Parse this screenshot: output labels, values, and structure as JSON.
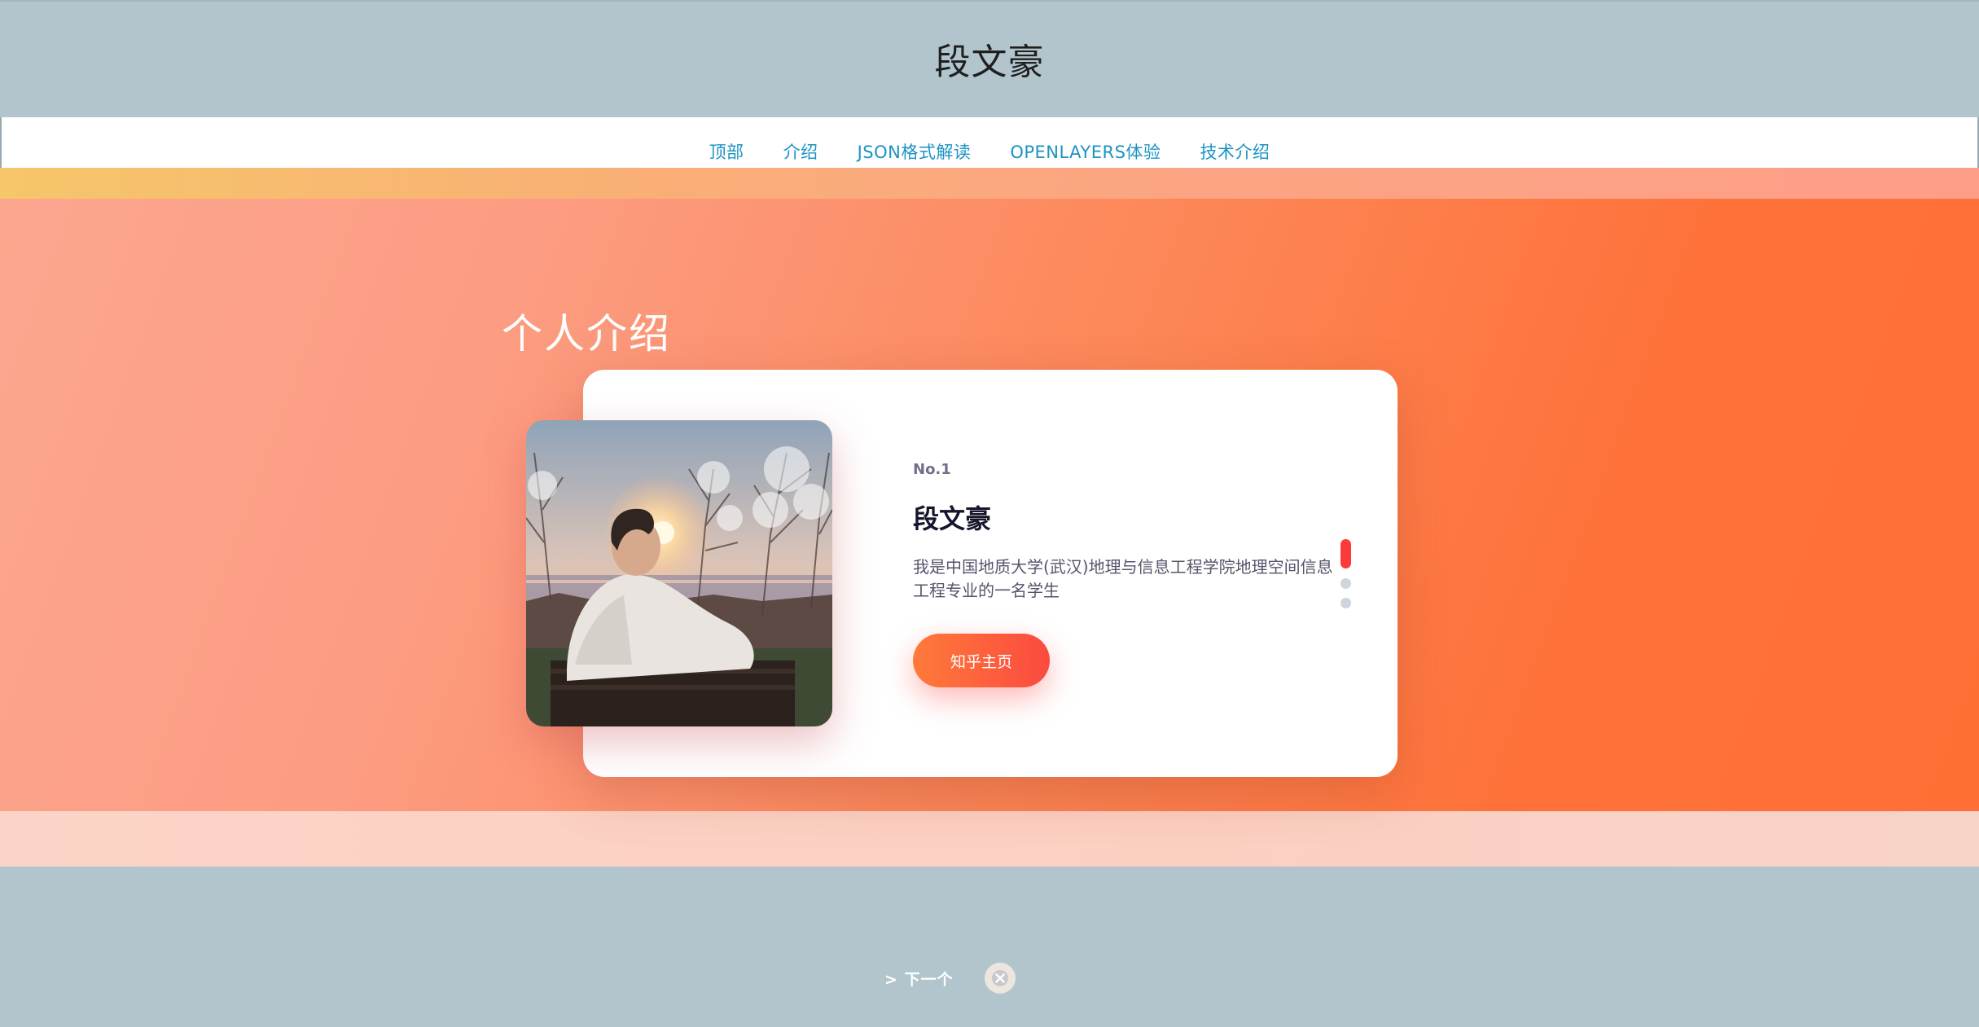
{
  "header": {
    "title": "段文豪"
  },
  "nav": {
    "items": [
      {
        "label": "顶部"
      },
      {
        "label": "介绍"
      },
      {
        "label": "JSON格式解读"
      },
      {
        "label": "OPENLAYERS体验"
      },
      {
        "label": "技术介绍"
      }
    ]
  },
  "section": {
    "title": "个人介绍"
  },
  "card": {
    "number": "No.1",
    "name": "段文豪",
    "description": "我是中国地质大学(武汉)地理与信息工程学院地理空间信息工程专业的一名学生",
    "button_label": "知乎主页",
    "slide_count": 3,
    "active_slide": 1
  },
  "footer": {
    "next_label": "> 下一个",
    "close_icon": "close-icon"
  },
  "colors": {
    "accent": "#fd3a3a",
    "nav_link": "#1b93c3",
    "background": "#b2c5cd"
  }
}
